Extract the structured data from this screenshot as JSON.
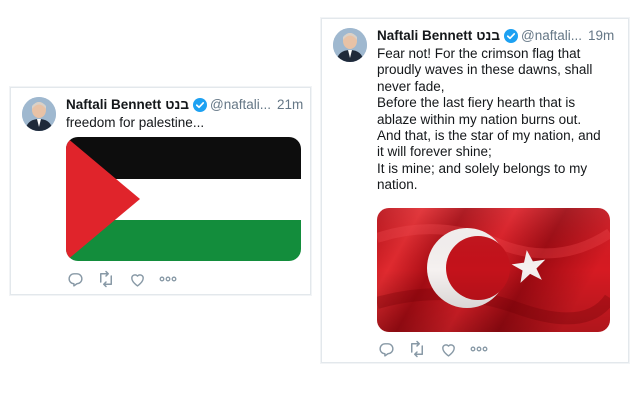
{
  "tweets": [
    {
      "author_name": "Naftali Bennett",
      "author_name_hebrew": "בנט",
      "handle": "@naftali...",
      "time": "21m",
      "text": "freedom for palestine...",
      "media": "palestine-flag-image",
      "icons": [
        "reply-icon",
        "retweet-icon",
        "like-icon",
        "more-icon"
      ]
    },
    {
      "author_name": "Naftali Bennett",
      "author_name_hebrew": "בנט",
      "handle": "@naftali...",
      "time": "19m",
      "text": "Fear not! For the crimson flag that\nproudly waves in these dawns, shall\nnever fade,\nBefore the last fiery hearth that is\nablaze within my nation burns out.\nAnd that, is the star of my nation, and\nit will forever shine;\nIt is mine; and solely belongs to my\nnation.",
      "media": "turkey-flag-image",
      "icons": [
        "reply-icon",
        "retweet-icon",
        "like-icon",
        "more-icon"
      ]
    }
  ],
  "colors": {
    "verified_blue": "#1da1f2",
    "text_primary": "#14171a",
    "text_secondary": "#657786",
    "palestine_red": "#e0242b",
    "palestine_green": "#138d3c",
    "turkey_red": "#d3171f"
  }
}
